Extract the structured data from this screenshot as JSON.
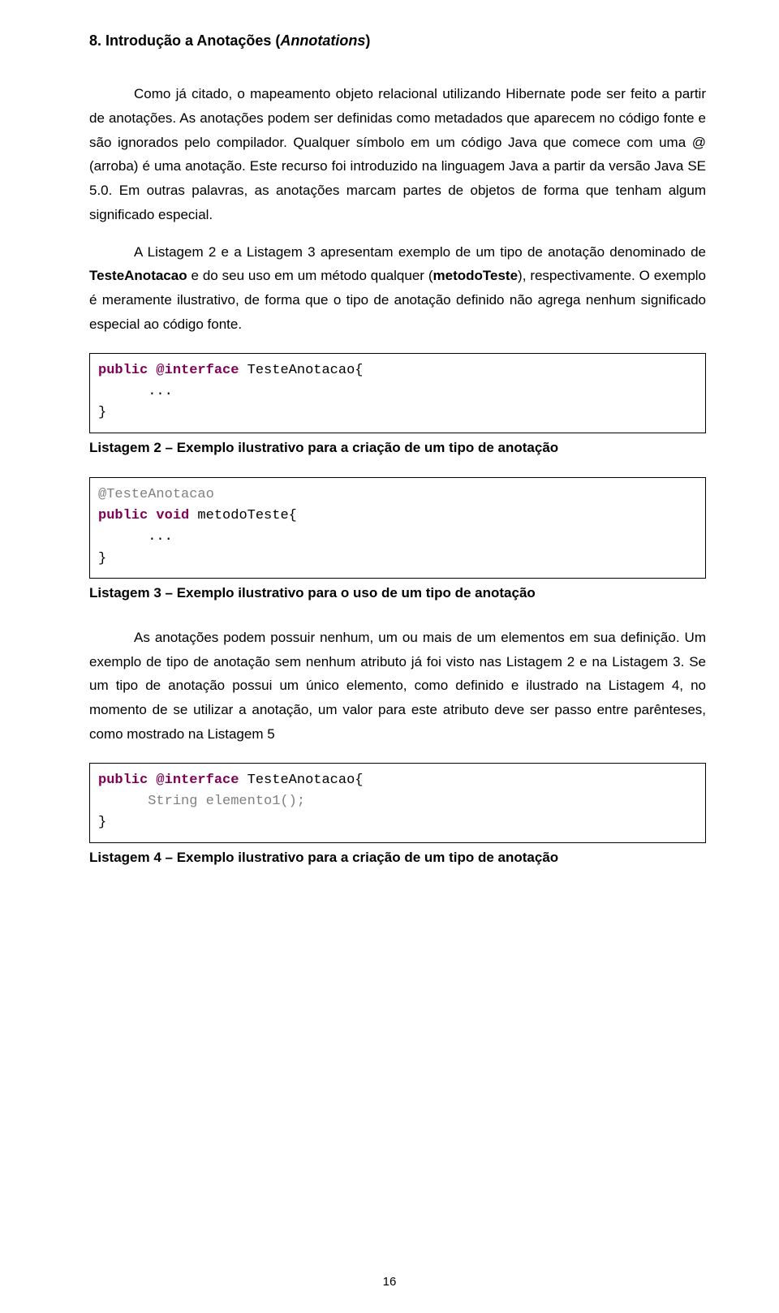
{
  "section": {
    "number": "8.",
    "title_plain": "Introdução a Anotações (",
    "title_italic": "Annotations",
    "title_close": ")"
  },
  "paragraphs": {
    "p1": "Como já citado, o mapeamento objeto relacional utilizando Hibernate pode ser feito a partir de anotações. As anotações podem ser definidas como metadados que aparecem no código fonte e são ignorados pelo compilador. Qualquer símbolo em um código Java que comece com uma @ (arroba) é uma anotação. Este recurso foi introduzido na linguagem Java a partir da versão Java SE 5.0. Em outras palavras, as anotações marcam partes de objetos de forma que tenham algum significado especial.",
    "p2_a": "A Listagem 2 e a Listagem 3 apresentam exemplo de um tipo de anotação denominado de ",
    "p2_bold1": "TesteAnotacao",
    "p2_b": "  e do seu uso em um método qualquer (",
    "p2_bold2": "metodoTeste",
    "p2_c": "), respectivamente. O exemplo é meramente ilustrativo, de forma que o tipo de anotação definido não agrega nenhum significado especial ao código fonte.",
    "p3": "As anotações podem possuir nenhum, um ou mais de um elementos em sua definição. Um exemplo de tipo de anotação sem nenhum atributo já foi visto nas Listagem 2 e na Listagem 3. Se um tipo de anotação possui um único elemento, como definido e ilustrado na Listagem 4, no momento de se utilizar a anotação, um valor para este atributo deve ser passo entre parênteses, como mostrado na Listagem 5"
  },
  "code1": {
    "kw1": "public",
    "kw2": "@interface",
    "name": " TesteAnotacao{",
    "line2": "      ...",
    "line3": "}"
  },
  "caption1": "Listagem 2 – Exemplo ilustrativo para a criação de um tipo de anotação",
  "code2": {
    "ann": "@TesteAnotacao",
    "kw1": "public",
    "kw2": "void",
    "name": " metodoTeste{",
    "line3": "      ...",
    "line4": "}"
  },
  "caption2": "Listagem 3 – Exemplo ilustrativo para o uso de um tipo de anotação",
  "code3": {
    "kw1": "public",
    "kw2": "@interface",
    "name": " TesteAnotacao{",
    "elem": "      String elemento1();",
    "close": "}"
  },
  "caption3": "Listagem 4 – Exemplo ilustrativo para a criação de um tipo de anotação",
  "page_number": "16"
}
